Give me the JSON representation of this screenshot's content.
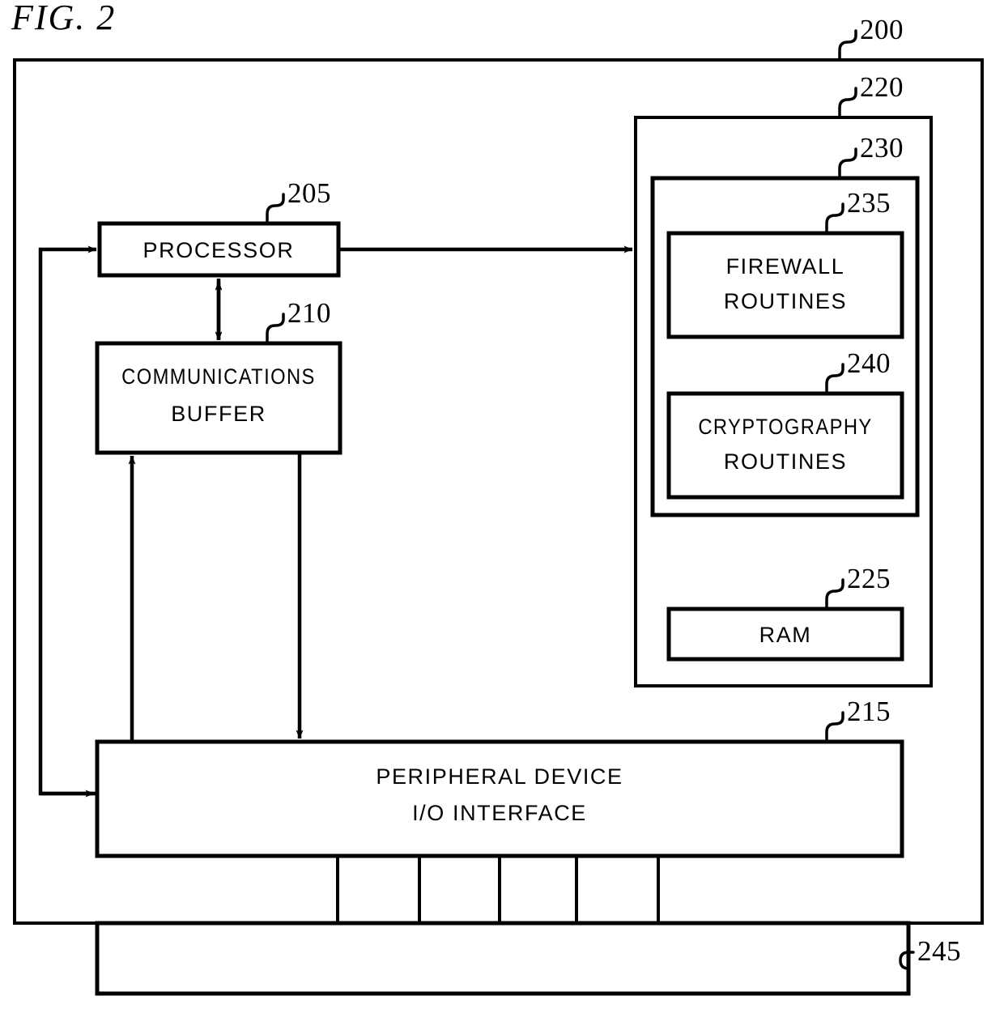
{
  "figure": {
    "title": "FIG.  2",
    "domain_note": "patent block diagram"
  },
  "reference_numerals": {
    "outer_system": "200",
    "processor": "205",
    "communications_buffer": "210",
    "io_interface": "215",
    "memory": "220",
    "ram": "225",
    "routines_container": "230",
    "firewall": "235",
    "cryptography": "240",
    "connector_target": "245"
  },
  "blocks": {
    "processor": {
      "label": "PROCESSOR",
      "ref": "205"
    },
    "communications_buffer": {
      "line1": "COMMUNICATIONS",
      "line2": "BUFFER",
      "ref": "210"
    },
    "io_interface": {
      "line1": "PERIPHERAL DEVICE",
      "line2": "I/O INTERFACE",
      "ref": "215"
    },
    "firewall_routines": {
      "line1": "FIREWALL",
      "line2": "ROUTINES",
      "ref": "235"
    },
    "cryptography_routines": {
      "line1": "CRYPTOGRAPHY",
      "line2": "ROUTINES",
      "ref": "240"
    },
    "ram": {
      "label": "RAM",
      "ref": "225"
    },
    "memory_container": {
      "label": "",
      "ref": "220"
    },
    "routines_container": {
      "label": "",
      "ref": "230"
    },
    "system_boundary": {
      "label": "",
      "ref": "200"
    },
    "connector_block": {
      "label": "",
      "ref": "245"
    }
  },
  "connector": {
    "pin_count": 5,
    "label": ""
  },
  "colors": {
    "ink": "#000000",
    "paper": "#ffffff"
  }
}
